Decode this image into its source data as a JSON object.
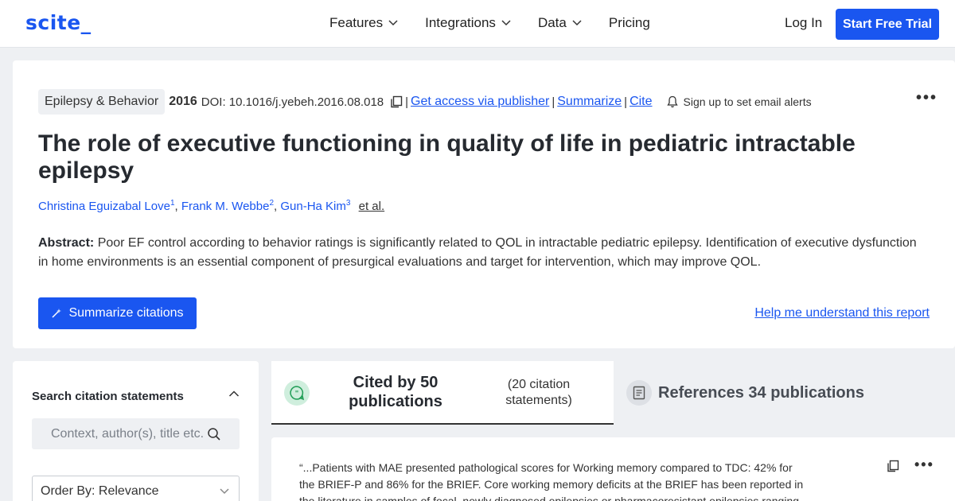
{
  "nav": {
    "logo": "scite_",
    "menu": [
      {
        "label": "Features",
        "has_dropdown": true
      },
      {
        "label": "Integrations",
        "has_dropdown": true
      },
      {
        "label": "Data",
        "has_dropdown": true
      },
      {
        "label": "Pricing",
        "has_dropdown": false
      }
    ],
    "login": "Log In",
    "trial": "Start Free Trial"
  },
  "paper": {
    "journal": "Epilepsy & Behavior",
    "year": "2016",
    "doi": "DOI: 10.1016/j.yebeh.2016.08.018",
    "sep": "|",
    "links": {
      "access": "Get access via publisher",
      "summarize": "Summarize",
      "cite": "Cite"
    },
    "alerts": "Sign up to set email alerts",
    "title": "The role of executive functioning in quality of life in pediatric intractable epilepsy",
    "authors": [
      {
        "name": "Christina Eguizabal Love",
        "aff": "1"
      },
      {
        "name": "Frank M. Webbe",
        "aff": "2"
      },
      {
        "name": "Gun-Ha Kim",
        "aff": "3"
      }
    ],
    "author_sep": ",",
    "etal": "et al.",
    "abstract_label": "Abstract:",
    "abstract": "Poor EF control according to behavior ratings is significantly related to QOL in intractable pediatric epilepsy. Identification of executive dysfunction in home environments is an essential component of presurgical evaluations and target for intervention, which may improve QOL.",
    "summarize_button": "Summarize citations",
    "help_link": "Help me understand this report"
  },
  "sidebar": {
    "title": "Search citation statements",
    "search_placeholder": "Context, author(s), title etc.",
    "order_by": "Order By: Relevance"
  },
  "tabs": {
    "cited_by": "Cited by 50 publications",
    "citation_statements": "(20 citation statements)",
    "references": "References 34 publications"
  },
  "quote": {
    "text": "“...Patients with MAE presented pathological scores for Working memory compared to TDC: 42% for the BRIEF-P and 86% for the BRIEF. Core working memory deficits at the BRIEF has been reported in the literature in samples of focal, newly diagnosed epilepsies or pharmacoresistant epilepsies ranging"
  },
  "colors": {
    "accent": "#1a56f0",
    "background": "#eef0f3",
    "cited_icon_bg": "#cfeedd",
    "cited_icon_fg": "#1f9d55"
  },
  "icons": {
    "copy": "copy-icon",
    "bell": "bell-icon",
    "search": "search-icon",
    "quote_bubble": "quote-bubble-icon",
    "document": "document-icon",
    "wand": "wand-icon",
    "more": "more-icon"
  }
}
